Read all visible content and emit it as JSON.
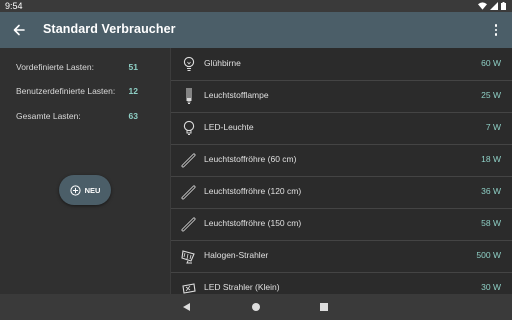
{
  "status": {
    "time": "9:54"
  },
  "header": {
    "title": "Standard Verbraucher"
  },
  "stats": [
    {
      "label": "Vordefinierte Lasten:",
      "value": "51"
    },
    {
      "label": "Benutzerdefinierte Lasten:",
      "value": "12"
    },
    {
      "label": "Gesamte Lasten:",
      "value": "63"
    }
  ],
  "fab": {
    "label": "NEU",
    "icon": "plus-circle-icon"
  },
  "items": [
    {
      "label": "Glühbirne",
      "watt": "60 W",
      "icon": "bulb-icon"
    },
    {
      "label": "Leuchtstofflampe",
      "watt": "25 W",
      "icon": "cfl-icon"
    },
    {
      "label": "LED-Leuchte",
      "watt": "7 W",
      "icon": "led-bulb-icon"
    },
    {
      "label": "Leuchtstoffröhre (60 cm)",
      "watt": "18 W",
      "icon": "tube-icon"
    },
    {
      "label": "Leuchtstoffröhre (120 cm)",
      "watt": "36 W",
      "icon": "tube-icon"
    },
    {
      "label": "Leuchtstoffröhre (150 cm)",
      "watt": "58 W",
      "icon": "tube-icon"
    },
    {
      "label": "Halogen-Strahler",
      "watt": "500 W",
      "icon": "floodlight-icon"
    },
    {
      "label": "LED Strahler (Klein)",
      "watt": "30 W",
      "icon": "floodlight-icon"
    }
  ],
  "colors": {
    "appbar": "#4b5e68",
    "accent": "#8fd0c6",
    "background": "#2b2b2b"
  }
}
